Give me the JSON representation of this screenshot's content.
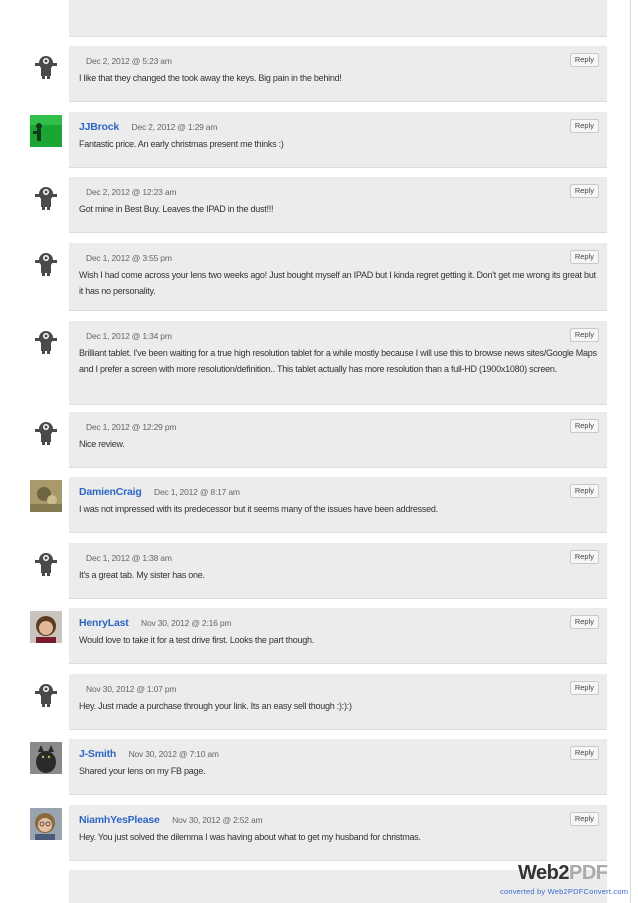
{
  "reply_label": "Reply",
  "comments": [
    {
      "author": "",
      "date": "Dec 2, 2012 @ 5:23 am",
      "text": "I like that they changed the took away the keys. Big pain in the behind!",
      "avatar": "robot-avatar"
    },
    {
      "author": "JJBrock",
      "date": "Dec 2, 2012 @ 1:29 am",
      "text": "Fantastic price. An early christmas present me thinks :)",
      "avatar": "green-figure-avatar"
    },
    {
      "author": "",
      "date": "Dec 2, 2012 @ 12:23 am",
      "text": "Got mine in Best Buy. Leaves the IPAD in the dust!!!",
      "avatar": "robot-avatar"
    },
    {
      "author": "",
      "date": "Dec 1, 2012 @ 3:55 pm",
      "text": "Wish I had come across your lens two weeks ago! Just bought myself an IPAD but I kinda regret getting it. Don't get me wrong its great but it has no personality.",
      "avatar": "robot-avatar"
    },
    {
      "author": "",
      "date": "Dec 1, 2012 @ 1:34 pm",
      "text": "Brilliant tablet. I've been waiting for a true high resolution tablet for a while mostly because I will use this to browse news sites/Google Maps and I prefer a screen with more resolution/definition.. This tablet actually has more resolution than a full-HD (1900x1080) screen.",
      "avatar": "robot-avatar"
    },
    {
      "author": "",
      "date": "Dec 1, 2012 @ 12:29 pm",
      "text": "Nice review.",
      "avatar": "robot-avatar"
    },
    {
      "author": "DamienCraig",
      "date": "Dec 1, 2012 @ 8:17 am",
      "text": "I was not impressed with its predecessor but it seems many of the issues have been addressed.",
      "avatar": "photo-avatar"
    },
    {
      "author": "",
      "date": "Dec 1, 2012 @ 1:38 am",
      "text": "It's a great tab. My sister has one.",
      "avatar": "robot-avatar"
    },
    {
      "author": "HenryLast",
      "date": "Nov 30, 2012 @ 2:16 pm",
      "text": "Would love to take it for a test drive first. Looks the part though.",
      "avatar": "photo-avatar"
    },
    {
      "author": "",
      "date": "Nov 30, 2012 @ 1:07 pm",
      "text": "Hey. Just made a purchase through your link. Its an easy sell though :):):)",
      "avatar": "robot-avatar"
    },
    {
      "author": "J-Smith",
      "date": "Nov 30, 2012 @ 7:10 am",
      "text": "Shared your lens on my FB page.",
      "avatar": "cat-photo-avatar"
    },
    {
      "author": "NiamhYesPlease",
      "date": "Nov 30, 2012 @ 2:52 am",
      "text": "Hey. You just solved the dilemma I was having about what to get my husband for christmas.",
      "avatar": "photo-avatar"
    }
  ],
  "footer": {
    "logo_web": "Web2",
    "logo_pdf": "PDF",
    "converted_by": "converted by Web2PDFConvert.com"
  }
}
